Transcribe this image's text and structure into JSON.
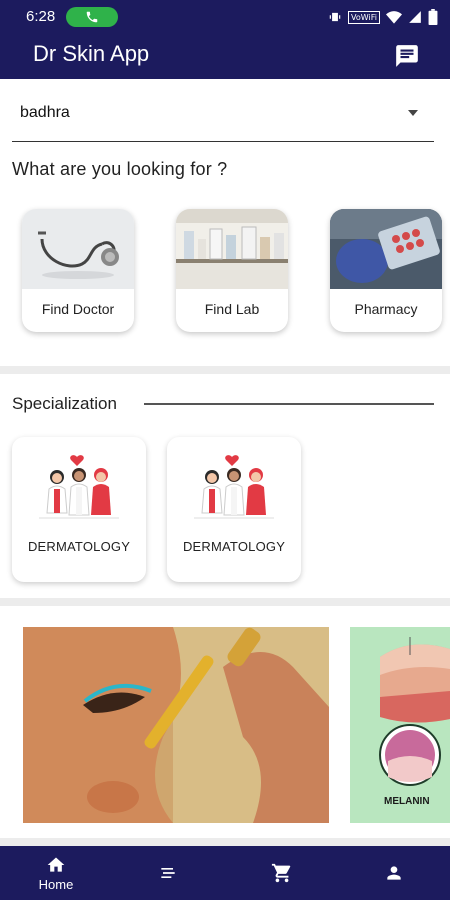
{
  "status_bar": {
    "time": "6:28",
    "network_badge": "VoWiFi",
    "icons": [
      "phone-icon",
      "vibrate-icon",
      "wifi-icon",
      "signal-icon",
      "battery-icon"
    ]
  },
  "app_bar": {
    "title": "Dr Skin App",
    "action_icon": "chat-icon"
  },
  "location": {
    "selected": "badhra"
  },
  "looking_for": {
    "heading": "What are you looking for ?",
    "categories": [
      {
        "label": "Find Doctor",
        "icon": "stethoscope-image"
      },
      {
        "label": "Find Lab",
        "icon": "lab-image"
      },
      {
        "label": "Pharmacy",
        "icon": "pharmacy-image"
      }
    ]
  },
  "specialization": {
    "heading": "Specialization",
    "items": [
      {
        "label": "DERMATOLOGY",
        "icon": "doctors-team-illustration"
      },
      {
        "label": "DERMATOLOGY",
        "icon": "doctors-team-illustration"
      }
    ]
  },
  "banners": [
    {
      "name": "skin-serum-banner"
    },
    {
      "name": "melanin-banner",
      "caption": "MELANIN"
    }
  ],
  "bottom_nav": [
    {
      "label": "Home",
      "icon": "home-icon",
      "active": true
    },
    {
      "label": "",
      "icon": "list-icon",
      "active": false
    },
    {
      "label": "",
      "icon": "cart-icon",
      "active": false
    },
    {
      "label": "",
      "icon": "profile-icon",
      "active": false
    }
  ],
  "colors": {
    "primary": "#1c1b5e",
    "call_pill": "#2fb24a",
    "divider": "#ececec"
  }
}
